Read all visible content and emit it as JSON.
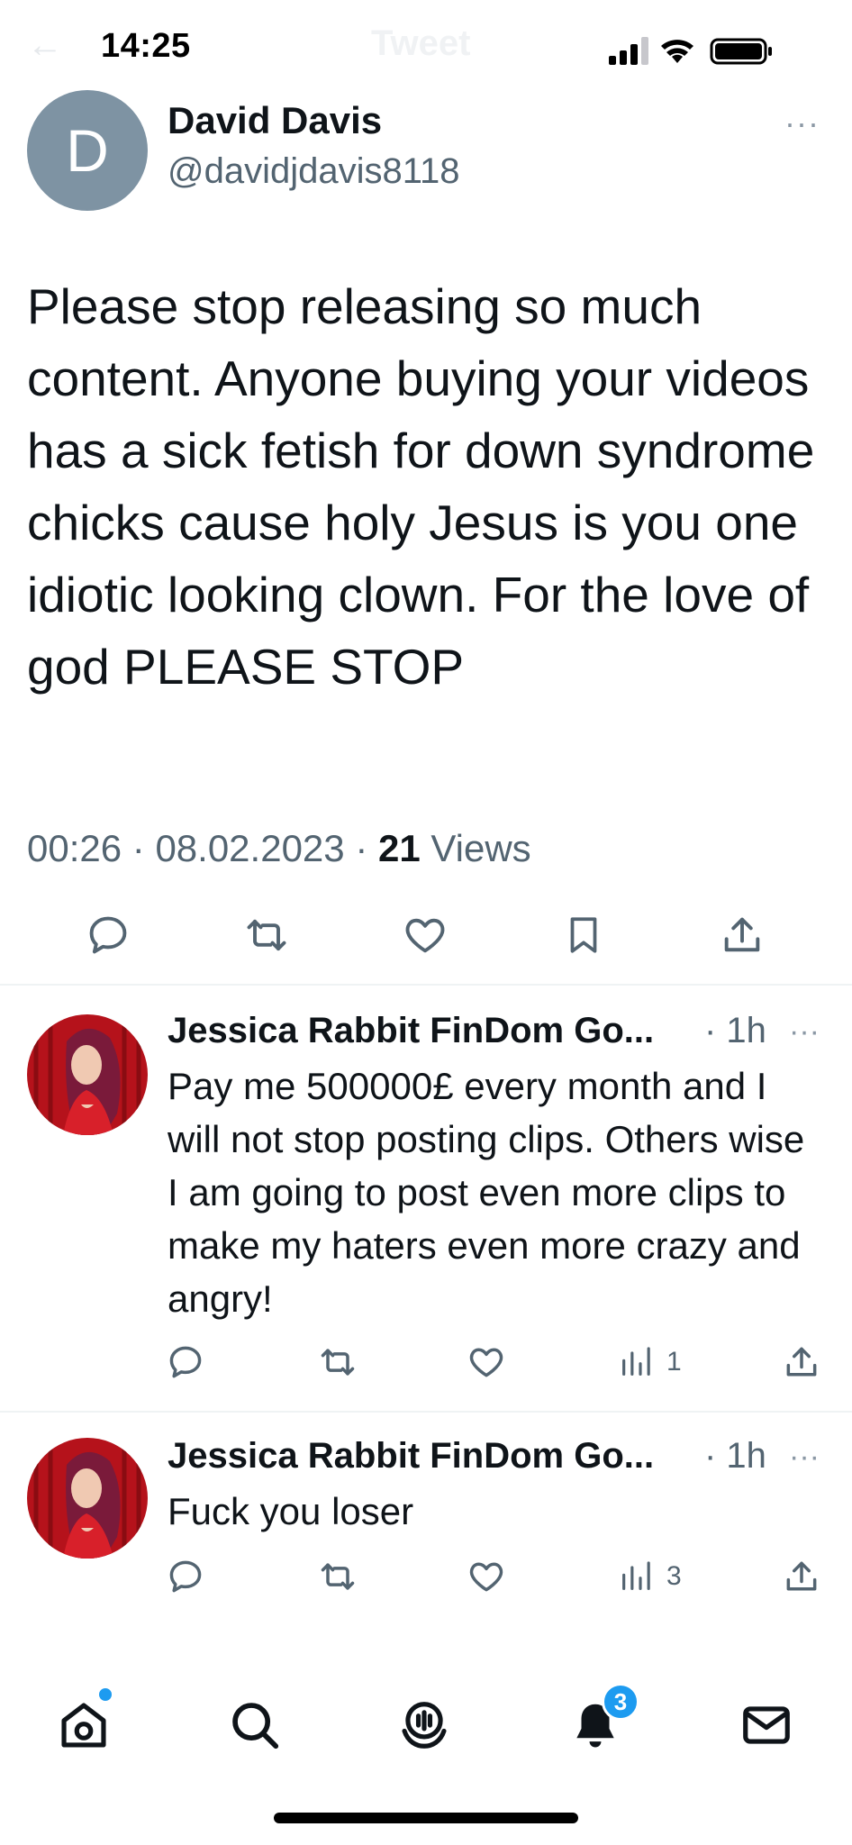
{
  "status_bar": {
    "time": "14:25",
    "signal_icon": "cellular-signal-icon",
    "wifi_icon": "wifi-icon",
    "battery_icon": "battery-icon"
  },
  "header": {
    "title": "Tweet",
    "back_icon": "back-arrow-icon"
  },
  "main_tweet": {
    "avatar_letter": "D",
    "name": "David Davis",
    "handle": "@davidjdavis8118",
    "more": "···",
    "text": "Please stop releasing so much content. Anyone buying your videos has a sick fetish for down syndrome chicks cause holy Jesus is you one idiotic looking clown. For the love of god PLEASE STOP",
    "time": "00:26",
    "date": "08.02.2023",
    "views_count": "21",
    "views_label": "Views",
    "actions": [
      "reply-icon",
      "retweet-icon",
      "like-icon",
      "bookmark-icon",
      "share-icon"
    ]
  },
  "replies": [
    {
      "name": "Jessica Rabbit FinDom Go...",
      "time": "· 1h",
      "more": "···",
      "text": "Pay me 500000£ every month and I will not stop posting clips. Others wise I am going to post even more clips to make my haters even more crazy and angry!",
      "views": "1"
    },
    {
      "name": "Jessica Rabbit FinDom Go...",
      "time": "· 1h",
      "more": "···",
      "text": "Fuck you loser",
      "views": "3"
    }
  ],
  "bottom_nav": {
    "items": [
      "home-icon",
      "search-icon",
      "spaces-icon",
      "notifications-icon",
      "messages-icon"
    ],
    "notification_badge": "3"
  },
  "colors": {
    "accent": "#1d9bf0",
    "text": "#0f1419",
    "secondary": "#536471",
    "divider": "#eff3f4",
    "avatar_gray": "#7e93a3",
    "avatar_red": "#c8161e"
  }
}
